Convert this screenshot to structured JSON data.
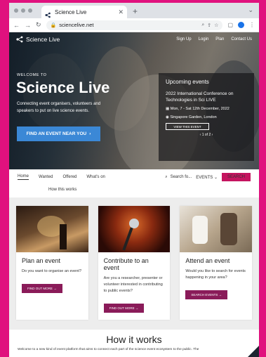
{
  "browser": {
    "tab_title": "Science Live",
    "url": "sciencelive.net"
  },
  "site": {
    "logo_text": "Science Live",
    "nav": [
      "Sign Up",
      "Login",
      "Plan",
      "Contact Us"
    ]
  },
  "hero": {
    "eyebrow": "WELCOME TO",
    "title": "Science Live",
    "description": "Connecting event organisers, volunteers and speakers to put on live science events.",
    "button_label": "FIND AN EVENT NEAR YOU"
  },
  "upcoming": {
    "heading": "Upcoming events",
    "event_title": "2022 International Conference on Technologies in Sci LIVE",
    "event_date": "Mon, 7 - Sat 12th December, 2022",
    "event_location": "Singapore Garden, London",
    "view_button": "VIEW THIS EVENT",
    "pager": "1 of 2"
  },
  "subnav": {
    "items": [
      "Home",
      "Wanted",
      "Offered",
      "What's on"
    ],
    "sub_item": "How this works",
    "search_placeholder": "Search fo...",
    "filter_label": "EVENTS",
    "search_button": "SEARCH"
  },
  "cards": [
    {
      "title": "Plan an event",
      "text": "Do you want to organise an event?",
      "button": "FIND OUT MORE"
    },
    {
      "title": "Contribute to an event",
      "text": "Are you a researcher, presenter or volunteer interested in contributing to public events?",
      "button": "FIND OUT MORE"
    },
    {
      "title": "Attend an event",
      "text": "Would you like to search for events happening in your area?",
      "button": "SEARCH EVENTS"
    }
  ],
  "how_it_works": {
    "heading": "How it works",
    "text": "Welcome to a new kind of event platform that aims to connect each part of the science event ecosystem to the public. The"
  },
  "colors": {
    "background": "#e0117e",
    "accent": "#c5145f",
    "card_button": "#8a1b59",
    "hero_button": "#3b88d6"
  }
}
